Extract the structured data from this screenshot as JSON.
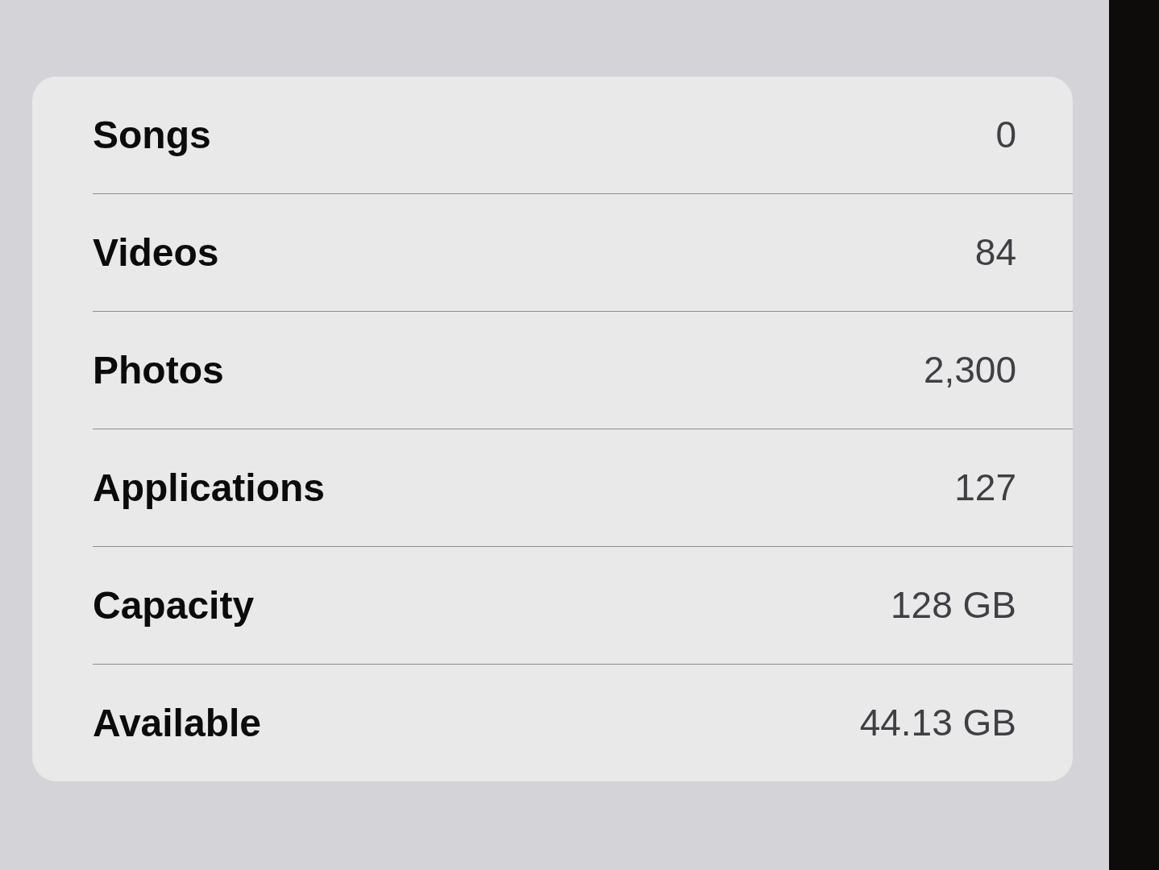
{
  "list": {
    "rows": [
      {
        "label": "Songs",
        "value": "0"
      },
      {
        "label": "Videos",
        "value": "84"
      },
      {
        "label": "Photos",
        "value": "2,300"
      },
      {
        "label": "Applications",
        "value": "127"
      },
      {
        "label": "Capacity",
        "value": "128 GB"
      },
      {
        "label": "Available",
        "value": "44.13 GB"
      }
    ]
  }
}
